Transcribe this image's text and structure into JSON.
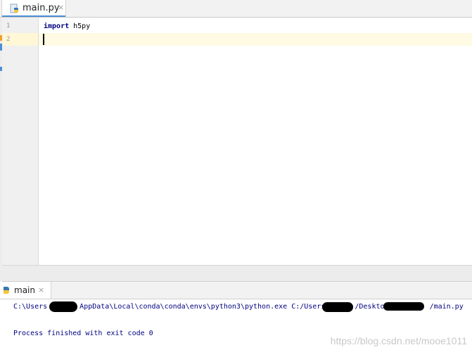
{
  "editor": {
    "tab": {
      "label": "main.py",
      "close": "×",
      "icon": "python-file-icon"
    },
    "line_numbers": [
      "1",
      "2"
    ],
    "code": [
      {
        "keyword": "import",
        "rest": " h5py"
      },
      {
        "keyword": "",
        "rest": ""
      }
    ]
  },
  "run_panel": {
    "tab": {
      "label": "main",
      "close": "×",
      "icon": "python-run-icon"
    },
    "console": {
      "command_prefix": "C:\\Users",
      "command_mid": "AppData\\Local\\conda\\conda\\envs\\python3\\python.exe C:/Users",
      "command_mid2": "/Desktop/",
      "command_suffix": "/main.py",
      "exit_message": "Process finished with exit code 0"
    }
  },
  "watermark": "https://blog.csdn.net/mooe1011",
  "colors": {
    "keyword": "#000080",
    "console_text": "#000080",
    "current_line": "#fffae3",
    "tab_underline": "#4a8fd6"
  }
}
